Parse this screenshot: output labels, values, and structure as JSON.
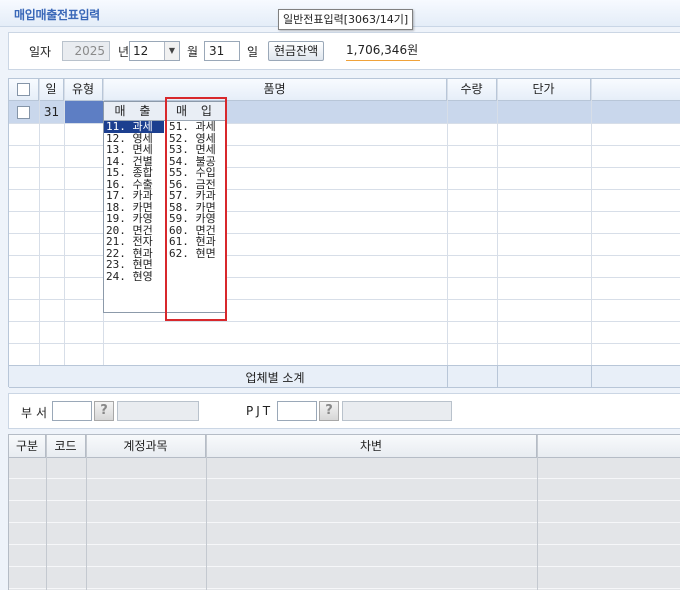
{
  "window": {
    "title": "매입매출전표입력",
    "tooltip": "일반전표입력[3063/14기]"
  },
  "date_bar": {
    "date_label": "일자",
    "year": "2025",
    "year_suffix": "년",
    "month": "12",
    "month_suffix": "월",
    "day": "31",
    "day_suffix": "일",
    "cash_balance_button": "현금잔액",
    "cash_balance_value": "1,706,346원"
  },
  "grid": {
    "headers": [
      "일",
      "유형",
      "품명",
      "수량",
      "단가"
    ],
    "first_row_day": "31",
    "subtotal_label": "업체별 소계"
  },
  "type_dropdown": {
    "tab_sales": "매 출",
    "tab_purchase": "매 입",
    "sales_items": [
      "11. 과세",
      "12. 영세",
      "13. 면세",
      "14. 건별",
      "15. 종합",
      "16. 수출",
      "17. 카과",
      "18. 카면",
      "19. 카영",
      "20. 면건",
      "21. 전자",
      "22. 현과",
      "23. 현면",
      "24. 현영"
    ],
    "purchase_items": [
      "51. 과세",
      "52. 영세",
      "53. 면세",
      "54. 불공",
      "55. 수입",
      "56. 금전",
      "57. 카과",
      "58. 카면",
      "59. 카영",
      "60. 면건",
      "61. 현과",
      "62. 현면"
    ],
    "highlighted_item": "11. 과세"
  },
  "dept_bar": {
    "dept_label": "부서",
    "pjt_label": "PJT",
    "help_glyph": "?"
  },
  "account_grid": {
    "headers": [
      "구분",
      "코드",
      "계정과목",
      "차변"
    ]
  },
  "colors": {
    "title": "#3a68b8",
    "highlight_box": "#d8282c",
    "selected_row": "#c9d7ec",
    "dropdown_highlight": "#1c3f8f",
    "balance_underline": "#f0a23a"
  }
}
